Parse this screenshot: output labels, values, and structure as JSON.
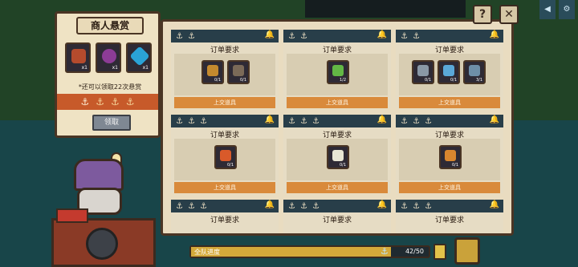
{
  "bounty_panel": {
    "title": "商人悬赏",
    "rewards": [
      {
        "icon": "chest-reward-icon",
        "count": "x1",
        "color": "#b54b2d"
      },
      {
        "icon": "orb-reward-icon",
        "count": "x1",
        "color": "#8c3c96"
      },
      {
        "icon": "crystal-reward-icon",
        "count": "x1",
        "color": "#2aa3d7"
      }
    ],
    "note": "*还可以领取22次悬赏",
    "anchors_collected": 1,
    "anchors_total": 4,
    "claim_label": "领取"
  },
  "orders": [
    {
      "title": "订单要求",
      "items": [
        {
          "icon": "carrot-bundle-icon",
          "count": "0/1",
          "color": "#c58a2e"
        },
        {
          "icon": "mushroom-basket-icon",
          "count": "0/1",
          "color": "#7b6a58"
        }
      ],
      "submit": "上交道具"
    },
    {
      "title": "订单要求",
      "items": [
        {
          "icon": "green-herb-icon",
          "count": "1/2",
          "color": "#63b845"
        }
      ],
      "submit": "上交道具"
    },
    {
      "title": "订单要求",
      "items": [
        {
          "icon": "gray-fish-icon",
          "count": "0/1",
          "color": "#8a98a6"
        },
        {
          "icon": "blue-fish-icon",
          "count": "0/1",
          "color": "#5aa8d8"
        },
        {
          "icon": "shrimp-icon",
          "count": "3/1",
          "color": "#6e8fa8"
        }
      ],
      "submit": "上交道具"
    },
    {
      "title": "订单要求",
      "items": [
        {
          "icon": "fried-food-icon",
          "count": "0/1",
          "color": "#d95a2a"
        }
      ],
      "submit": "上交道具"
    },
    {
      "title": "订单要求",
      "items": [
        {
          "icon": "rice-dish-icon",
          "count": "0/1",
          "color": "#e8e6d4"
        }
      ],
      "submit": "上交道具"
    },
    {
      "title": "订单要求",
      "items": [
        {
          "icon": "stew-bowl-icon",
          "count": "0/1",
          "color": "#d9862e"
        }
      ],
      "submit": "上交道具"
    },
    {
      "title": "订单要求",
      "items": [],
      "submit": ""
    },
    {
      "title": "订单要求",
      "items": [],
      "submit": ""
    },
    {
      "title": "订单要求",
      "items": [],
      "submit": ""
    }
  ],
  "buttons": {
    "help": "?",
    "close": "✕"
  },
  "progress": {
    "label": "全队进度",
    "current": 42,
    "total": 50,
    "text": "42/50"
  },
  "colors": {
    "board_bg": "#e9dcc0",
    "header": "#283e49",
    "submit": "#d98a3b",
    "anchor_strip": "#c75a2a"
  }
}
